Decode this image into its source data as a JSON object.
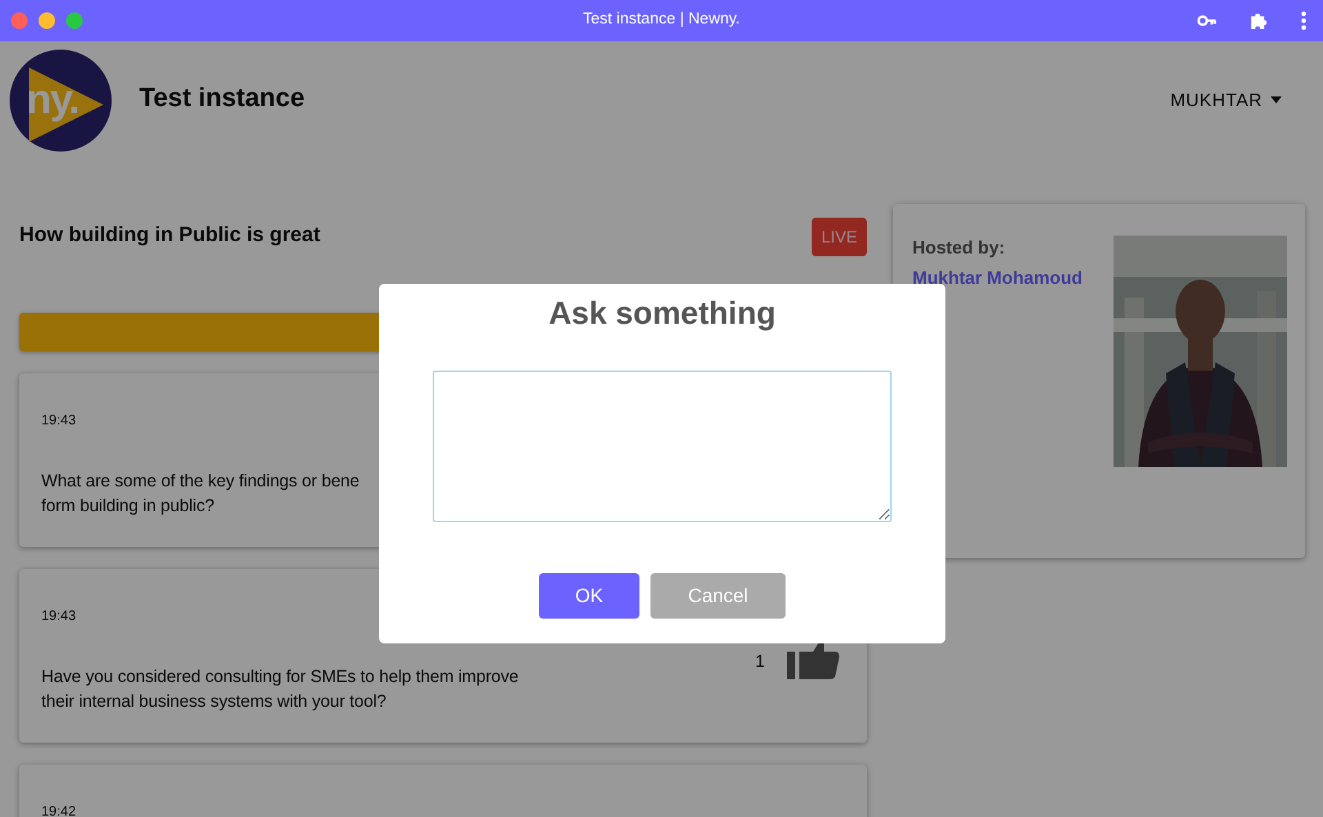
{
  "window": {
    "title": "Test instance | Newny."
  },
  "header": {
    "logo_text": "ny.",
    "title": "Test instance",
    "user_menu": "MUKHTAR"
  },
  "session": {
    "title": "How building in Public is great",
    "badge": "LIVE"
  },
  "questions": [
    {
      "time": "19:43",
      "lines": [
        "What are some of the key findings or bene",
        "form building in public?"
      ]
    },
    {
      "time": "19:43",
      "lines": [
        "Have you considered consulting for SMEs to help them improve",
        "their internal business systems with your tool?"
      ],
      "votes": "1"
    },
    {
      "time": "19:42"
    }
  ],
  "host": {
    "label": "Hosted by:",
    "name": "Mukhtar Mohamoud"
  },
  "dialog": {
    "title": "Ask something",
    "buttons": [
      {
        "label": "OK",
        "kind": "primary"
      },
      {
        "label": "Cancel",
        "kind": "secondary"
      }
    ]
  }
}
